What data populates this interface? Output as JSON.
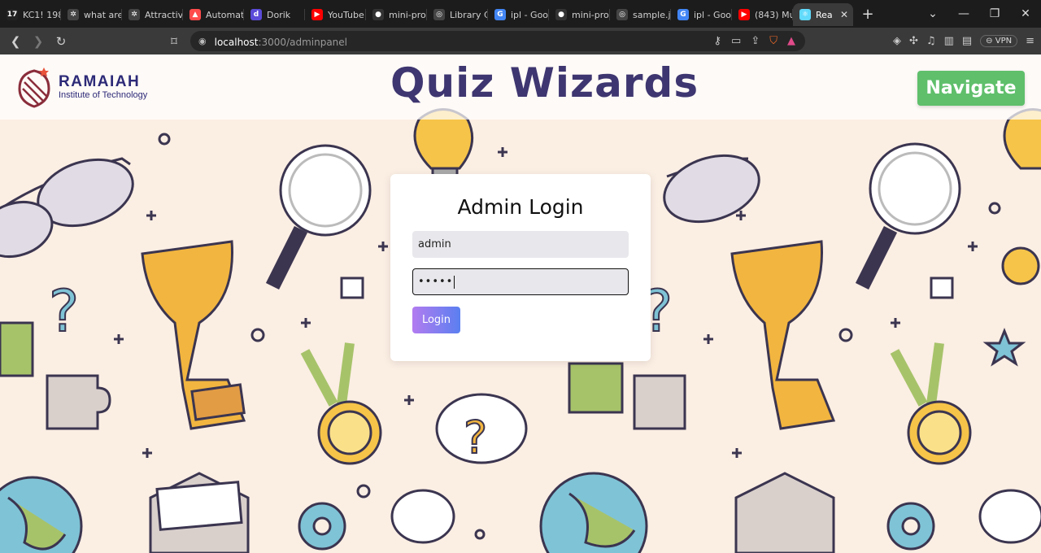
{
  "browser": {
    "tabs": [
      {
        "title": "KC1! 198",
        "icon": "tradingview-icon",
        "color": "#222222"
      },
      {
        "title": "what are",
        "icon": "chatgpt-icon",
        "color": "#444444"
      },
      {
        "title": "Attractiv",
        "icon": "chatgpt-icon",
        "color": "#444444"
      },
      {
        "title": "Automat",
        "icon": "streamlit-icon",
        "color": "#ff4b4b"
      },
      {
        "title": "Dorik",
        "icon": "dorik-icon",
        "color": "#5b4bd8"
      },
      {
        "title": "YouTube",
        "icon": "youtube-icon",
        "color": "#ff0000"
      },
      {
        "title": "mini-pro",
        "icon": "github-icon",
        "color": "#333333"
      },
      {
        "title": "Library C",
        "icon": "globe-icon",
        "color": "#444444"
      },
      {
        "title": "ipl - Goo",
        "icon": "google-icon",
        "color": "#4285f4"
      },
      {
        "title": "mini-pro",
        "icon": "github-icon",
        "color": "#333333"
      },
      {
        "title": "sample.j",
        "icon": "globe-icon",
        "color": "#444444"
      },
      {
        "title": "ipl - Goo",
        "icon": "google-icon",
        "color": "#4285f4"
      },
      {
        "title": "(843) Mu",
        "icon": "youtube-icon",
        "color": "#ff0000"
      },
      {
        "title": "Rea",
        "icon": "react-icon",
        "color": "#61dafb",
        "active": true
      }
    ],
    "url_host": "localhost",
    "url_rest": ":3000/adminpanel",
    "vpn_label": "VPN"
  },
  "header": {
    "logo_line1": "RAMAIAH",
    "logo_line2": "Institute of Technology",
    "title": "Quiz Wizards",
    "nav_button": "Navigate"
  },
  "login": {
    "title": "Admin Login",
    "username_value": "admin",
    "password_mask": "•••••",
    "button_label": "Login"
  },
  "colors": {
    "header_title": "#3e3670",
    "navigate_button": "#5fbf6b",
    "login_gradient_start": "#b27cf0",
    "login_gradient_end": "#5a7ff0",
    "page_bg": "#fbeee3"
  }
}
